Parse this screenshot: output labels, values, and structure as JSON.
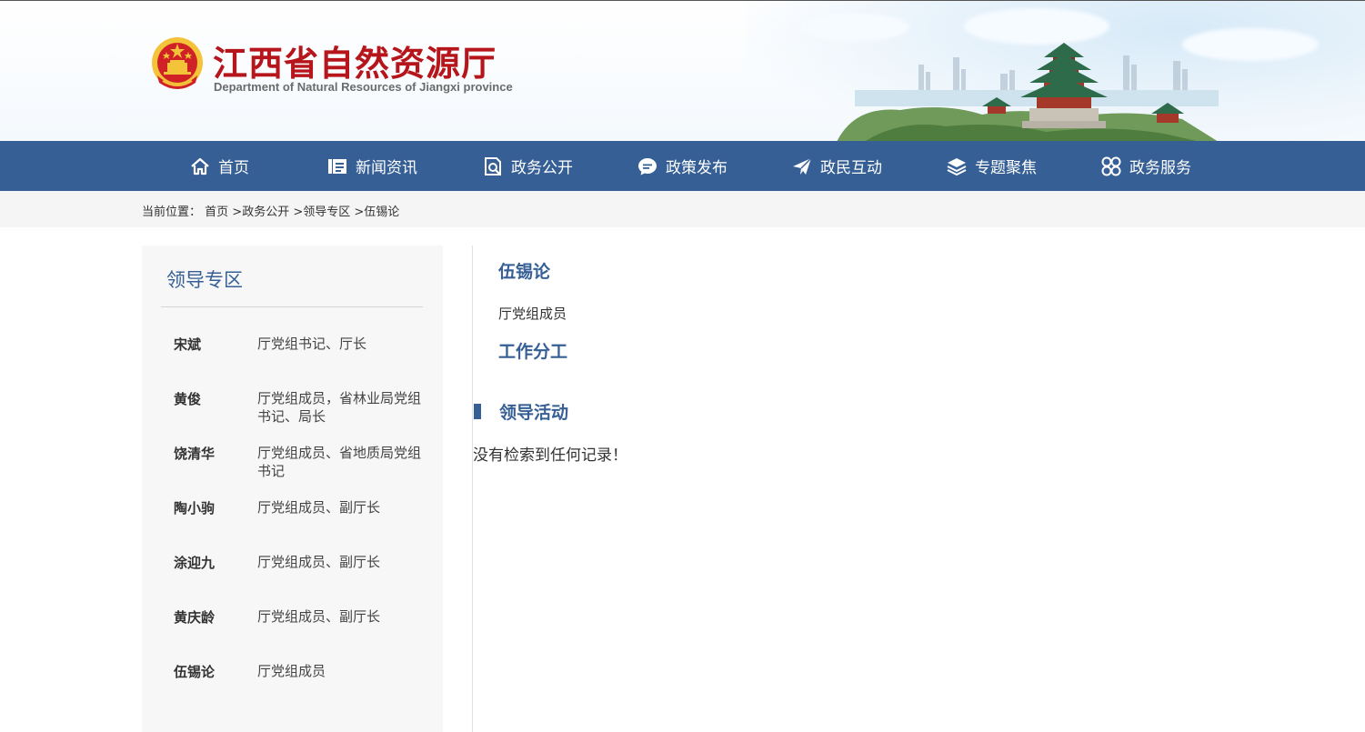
{
  "header": {
    "title": "江西省自然资源厅",
    "subtitle": "Department of Natural Resources of Jiangxi province",
    "logo_icon": "national-emblem-icon",
    "title_color": "#b5151b"
  },
  "nav": {
    "background": "#365f96",
    "items": [
      {
        "label": "首页",
        "icon": "home-icon"
      },
      {
        "label": "新闻资讯",
        "icon": "news-icon"
      },
      {
        "label": "政务公开",
        "icon": "document-search-icon"
      },
      {
        "label": "政策发布",
        "icon": "chat-bubble-icon"
      },
      {
        "label": "政民互动",
        "icon": "paper-plane-icon"
      },
      {
        "label": "专题聚焦",
        "icon": "layers-icon"
      },
      {
        "label": "政务服务",
        "icon": "four-circles-icon"
      }
    ]
  },
  "breadcrumb": {
    "prefix": "当前位置：",
    "items": [
      "首页",
      "政务公开",
      "领导专区",
      "伍锡论"
    ],
    "separator": " >"
  },
  "sidebar": {
    "title": "领导专区",
    "leaders": [
      {
        "name": "宋斌",
        "role": "厅党组书记、厅长"
      },
      {
        "name": "黄俊",
        "role": "厅党组成员，省林业局党组书记、局长"
      },
      {
        "name": "饶清华",
        "role": "厅党组成员、省地质局党组书记"
      },
      {
        "name": "陶小驹",
        "role": "厅党组成员、副厅长"
      },
      {
        "name": "涂迎九",
        "role": "厅党组成员、副厅长"
      },
      {
        "name": "黄庆龄",
        "role": "厅党组成员、副厅长"
      },
      {
        "name": "伍锡论",
        "role": "厅党组成员"
      }
    ]
  },
  "main": {
    "name": "伍锡论",
    "post": "厅党组成员",
    "duty_title": "工作分工",
    "activity_title": "领导活动",
    "empty_message": "没有检索到任何记录！"
  }
}
